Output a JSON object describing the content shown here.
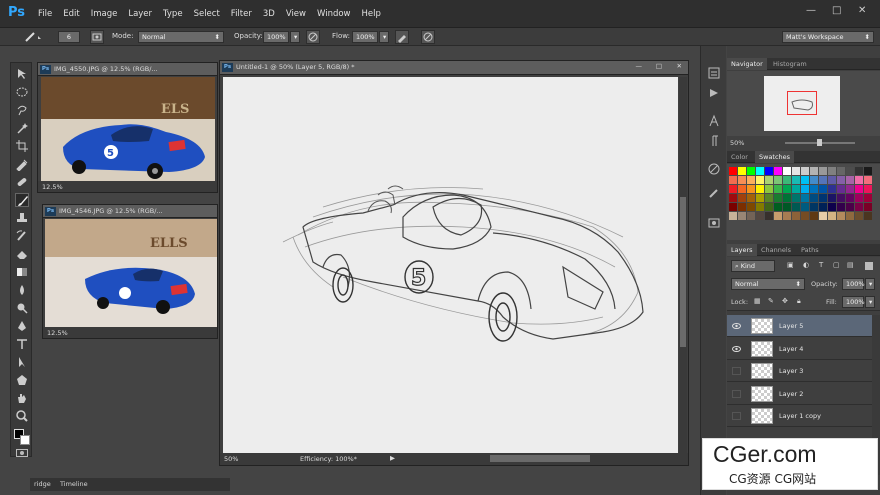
{
  "app": {
    "logo": "Ps"
  },
  "menu": [
    "File",
    "Edit",
    "Image",
    "Layer",
    "Type",
    "Select",
    "Filter",
    "3D",
    "View",
    "Window",
    "Help"
  ],
  "window_controls": {
    "minimize": "—",
    "maximize": "□",
    "close": "✕"
  },
  "options": {
    "brush_size": "6",
    "mode_label": "Mode:",
    "mode_value": "Normal",
    "opacity_label": "Opacity:",
    "opacity_value": "100%",
    "flow_label": "Flow:",
    "flow_value": "100%",
    "workspace": "Matt's Workspace"
  },
  "docs": [
    {
      "title": "IMG_4550.JPG @ 12.5% (RGB/...",
      "zoom": "12.5%"
    },
    {
      "title": "IMG_4546.JPG @ 12.5% (RGB/...",
      "zoom": "12.5%"
    },
    {
      "title": "Untitled-1 @ 50% (Layer 5, RGB/8) *",
      "zoom": "50%",
      "efficiency": "Efficiency: 100%*"
    }
  ],
  "photo_text": [
    "ELS",
    "ELLS"
  ],
  "car_number": "5",
  "navigator": {
    "tabs": [
      "Navigator",
      "Histogram"
    ],
    "zoom": "50%"
  },
  "color_panel": {
    "tabs": [
      "Color",
      "Swatches"
    ]
  },
  "layers_panel": {
    "tabs": [
      "Layers",
      "Channels",
      "Paths"
    ],
    "kind": "Kind",
    "blend": "Normal",
    "opacity_label": "Opacity:",
    "opacity_value": "100%",
    "lock_label": "Lock:",
    "fill_label": "Fill:",
    "fill_value": "100%",
    "layers": [
      {
        "name": "Layer 5",
        "visible": true,
        "selected": true
      },
      {
        "name": "Layer 4",
        "visible": true,
        "selected": false
      },
      {
        "name": "Layer 3",
        "visible": false,
        "selected": false
      },
      {
        "name": "Layer 2",
        "visible": false,
        "selected": false
      },
      {
        "name": "Layer 1 copy",
        "visible": false,
        "selected": false
      }
    ]
  },
  "bottom_tabs": [
    "ridge",
    "Timeline"
  ],
  "watermark": {
    "line1": "CGer.com",
    "line2": "CG资源 CG网站"
  }
}
